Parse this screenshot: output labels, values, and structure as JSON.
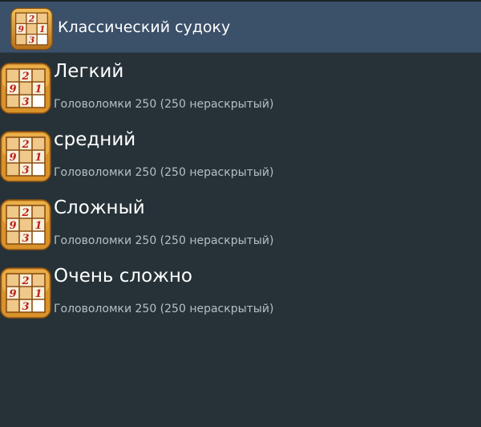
{
  "action_bar": {
    "title": "Классический судоку",
    "icon": "sudoku-grid-icon",
    "background": "#3b5069"
  },
  "icon_digits": {
    "top_middle": "2",
    "middle_left": "9",
    "middle_right": "1",
    "bottom_middle": "3"
  },
  "difficulty_list": {
    "items": [
      {
        "title": "Легкий",
        "subtitle": "Головоломки 250 (250 нераскрытый)"
      },
      {
        "title": "средний",
        "subtitle": "Головоломки 250 (250 нераскрытый)"
      },
      {
        "title": "Сложный",
        "subtitle": "Головоломки 250 (250 нераскрытый)"
      },
      {
        "title": "Очень сложно",
        "subtitle": "Головоломки 250 (250 нераскрытый)"
      }
    ]
  },
  "colors": {
    "background": "#263238",
    "title_text": "#ffffff",
    "subtitle_text": "#b7bfc4",
    "icon_frame": "#d9922a",
    "icon_digit": "#c0201a"
  }
}
